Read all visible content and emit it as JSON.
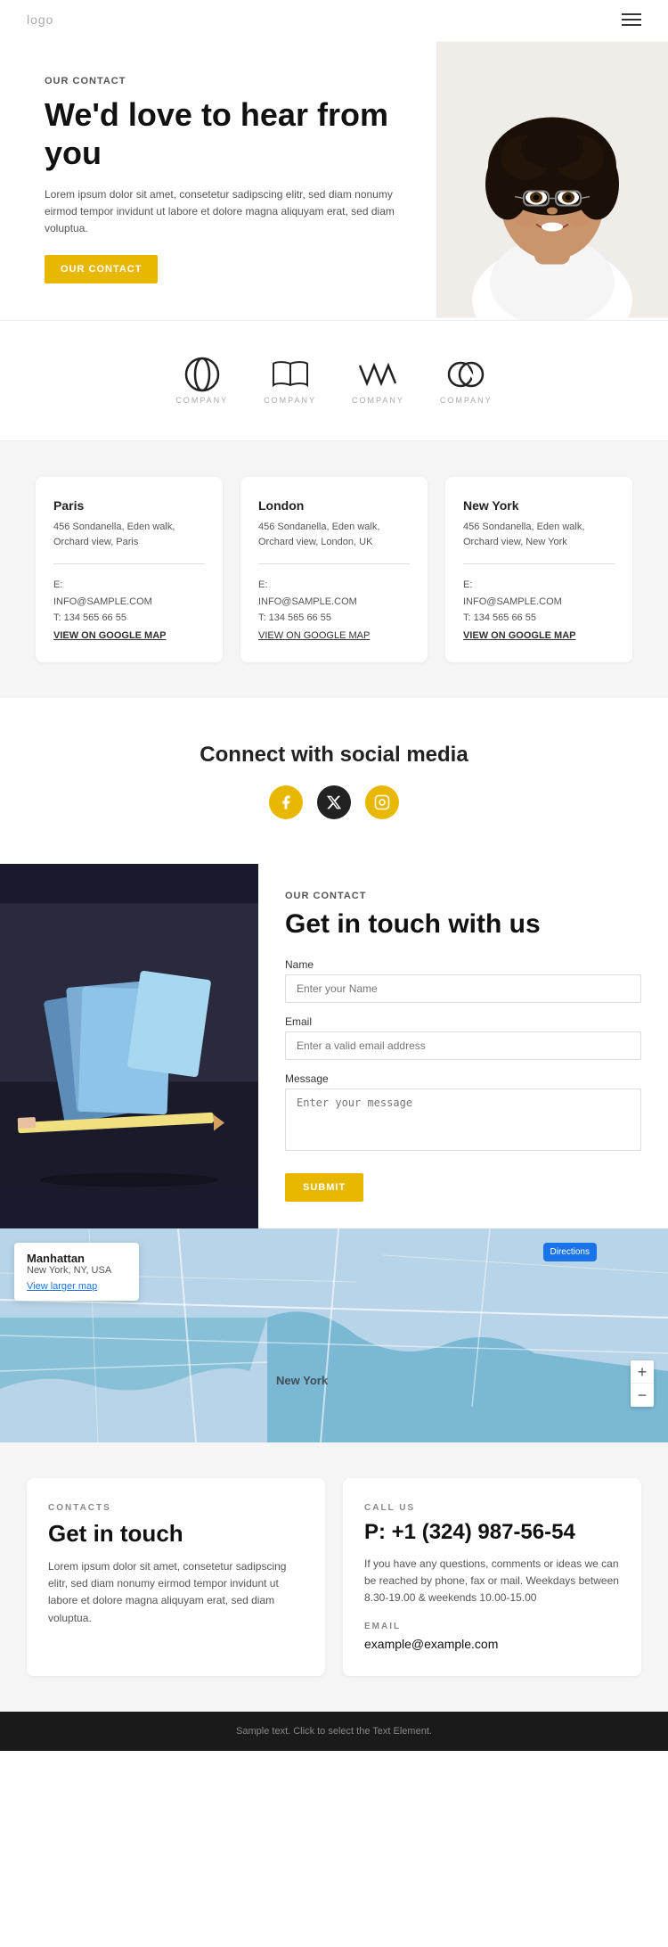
{
  "navbar": {
    "logo": "logo",
    "menu_icon": "menu"
  },
  "hero": {
    "label": "OUR CONTACT",
    "title": "We'd love to hear from you",
    "description": "Lorem ipsum dolor sit amet, consetetur sadipscing elitr, sed diam nonumy eirmod tempor invidunt ut labore et dolore magna aliquyam erat, sed diam voluptua.",
    "cta_label": "OUR CONTACT"
  },
  "logos": [
    {
      "id": "logo1",
      "label": "COMPANY"
    },
    {
      "id": "logo2",
      "label": "COMPANY"
    },
    {
      "id": "logo3",
      "label": "COMPANY"
    },
    {
      "id": "logo4",
      "label": "COMPANY"
    }
  ],
  "offices": [
    {
      "city": "Paris",
      "address": "456 Sondanella, Eden walk, Orchard view, Paris",
      "email_label": "E:",
      "email": "INFO@SAMPLE.COM",
      "phone_label": "T:",
      "phone": "134 565 66 55",
      "map_link": "VIEW ON GOOGLE MAP"
    },
    {
      "city": "London",
      "address": "456 Sondanella, Eden walk, Orchard view, London, UK",
      "email_label": "E:",
      "email": "INFO@SAMPLE.COM",
      "phone_label": "T:",
      "phone": "134 565 66 55",
      "map_link": "VIEW ON GOOGLE MAP"
    },
    {
      "city": "New York",
      "address": "456 Sondanella, Eden walk, Orchard view, New York",
      "email_label": "E:",
      "email": "INFO@SAMPLE.COM",
      "phone_label": "T:",
      "phone": "134 565 66 55",
      "map_link": "VIEW ON GOOGLE MAP"
    }
  ],
  "social": {
    "title": "Connect with social media",
    "icons": [
      "f",
      "x",
      "ig"
    ]
  },
  "contact_form": {
    "label": "OUR CONTACT",
    "title": "Get in touch with us",
    "name_label": "Name",
    "name_placeholder": "Enter your Name",
    "email_label": "Email",
    "email_placeholder": "Enter a valid email address",
    "message_label": "Message",
    "message_placeholder": "Enter your message",
    "submit_label": "SUBMIT"
  },
  "map": {
    "city": "Manhattan",
    "state": "New York, NY, USA",
    "directions_label": "Directions",
    "view_larger": "View larger map",
    "zoom_in": "+",
    "zoom_out": "−"
  },
  "bottom_contacts": {
    "contacts_card": {
      "label": "CONTACTS",
      "title": "Get in touch",
      "description": "Lorem ipsum dolor sit amet, consetetur sadipscing elitr, sed diam nonumy eirmod tempor invidunt ut labore et dolore magna aliquyam erat, sed diam voluptua."
    },
    "call_card": {
      "label": "CALL US",
      "phone": "P: +1 (324) 987-56-54",
      "description": "If you have any questions, comments or ideas we can be reached by phone, fax or mail. Weekdays between 8.30-19.00 & weekends 10.00-15.00",
      "email_label": "EMAIL",
      "email": "example@example.com"
    }
  },
  "footer": {
    "text": "Sample text. Click to select the Text Element."
  }
}
